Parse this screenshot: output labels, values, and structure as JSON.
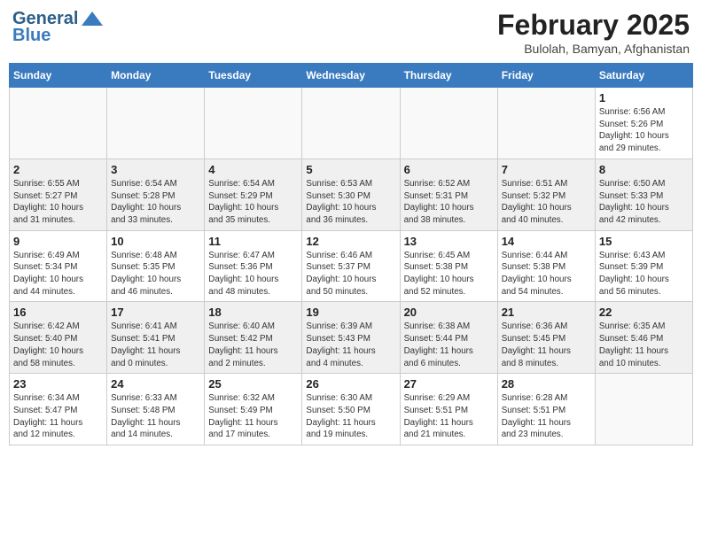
{
  "header": {
    "logo_general": "General",
    "logo_blue": "Blue",
    "month": "February 2025",
    "location": "Bulolah, Bamyan, Afghanistan"
  },
  "weekdays": [
    "Sunday",
    "Monday",
    "Tuesday",
    "Wednesday",
    "Thursday",
    "Friday",
    "Saturday"
  ],
  "weeks": [
    [
      {
        "day": "",
        "info": ""
      },
      {
        "day": "",
        "info": ""
      },
      {
        "day": "",
        "info": ""
      },
      {
        "day": "",
        "info": ""
      },
      {
        "day": "",
        "info": ""
      },
      {
        "day": "",
        "info": ""
      },
      {
        "day": "1",
        "info": "Sunrise: 6:56 AM\nSunset: 5:26 PM\nDaylight: 10 hours\nand 29 minutes."
      }
    ],
    [
      {
        "day": "2",
        "info": "Sunrise: 6:55 AM\nSunset: 5:27 PM\nDaylight: 10 hours\nand 31 minutes."
      },
      {
        "day": "3",
        "info": "Sunrise: 6:54 AM\nSunset: 5:28 PM\nDaylight: 10 hours\nand 33 minutes."
      },
      {
        "day": "4",
        "info": "Sunrise: 6:54 AM\nSunset: 5:29 PM\nDaylight: 10 hours\nand 35 minutes."
      },
      {
        "day": "5",
        "info": "Sunrise: 6:53 AM\nSunset: 5:30 PM\nDaylight: 10 hours\nand 36 minutes."
      },
      {
        "day": "6",
        "info": "Sunrise: 6:52 AM\nSunset: 5:31 PM\nDaylight: 10 hours\nand 38 minutes."
      },
      {
        "day": "7",
        "info": "Sunrise: 6:51 AM\nSunset: 5:32 PM\nDaylight: 10 hours\nand 40 minutes."
      },
      {
        "day": "8",
        "info": "Sunrise: 6:50 AM\nSunset: 5:33 PM\nDaylight: 10 hours\nand 42 minutes."
      }
    ],
    [
      {
        "day": "9",
        "info": "Sunrise: 6:49 AM\nSunset: 5:34 PM\nDaylight: 10 hours\nand 44 minutes."
      },
      {
        "day": "10",
        "info": "Sunrise: 6:48 AM\nSunset: 5:35 PM\nDaylight: 10 hours\nand 46 minutes."
      },
      {
        "day": "11",
        "info": "Sunrise: 6:47 AM\nSunset: 5:36 PM\nDaylight: 10 hours\nand 48 minutes."
      },
      {
        "day": "12",
        "info": "Sunrise: 6:46 AM\nSunset: 5:37 PM\nDaylight: 10 hours\nand 50 minutes."
      },
      {
        "day": "13",
        "info": "Sunrise: 6:45 AM\nSunset: 5:38 PM\nDaylight: 10 hours\nand 52 minutes."
      },
      {
        "day": "14",
        "info": "Sunrise: 6:44 AM\nSunset: 5:38 PM\nDaylight: 10 hours\nand 54 minutes."
      },
      {
        "day": "15",
        "info": "Sunrise: 6:43 AM\nSunset: 5:39 PM\nDaylight: 10 hours\nand 56 minutes."
      }
    ],
    [
      {
        "day": "16",
        "info": "Sunrise: 6:42 AM\nSunset: 5:40 PM\nDaylight: 10 hours\nand 58 minutes."
      },
      {
        "day": "17",
        "info": "Sunrise: 6:41 AM\nSunset: 5:41 PM\nDaylight: 11 hours\nand 0 minutes."
      },
      {
        "day": "18",
        "info": "Sunrise: 6:40 AM\nSunset: 5:42 PM\nDaylight: 11 hours\nand 2 minutes."
      },
      {
        "day": "19",
        "info": "Sunrise: 6:39 AM\nSunset: 5:43 PM\nDaylight: 11 hours\nand 4 minutes."
      },
      {
        "day": "20",
        "info": "Sunrise: 6:38 AM\nSunset: 5:44 PM\nDaylight: 11 hours\nand 6 minutes."
      },
      {
        "day": "21",
        "info": "Sunrise: 6:36 AM\nSunset: 5:45 PM\nDaylight: 11 hours\nand 8 minutes."
      },
      {
        "day": "22",
        "info": "Sunrise: 6:35 AM\nSunset: 5:46 PM\nDaylight: 11 hours\nand 10 minutes."
      }
    ],
    [
      {
        "day": "23",
        "info": "Sunrise: 6:34 AM\nSunset: 5:47 PM\nDaylight: 11 hours\nand 12 minutes."
      },
      {
        "day": "24",
        "info": "Sunrise: 6:33 AM\nSunset: 5:48 PM\nDaylight: 11 hours\nand 14 minutes."
      },
      {
        "day": "25",
        "info": "Sunrise: 6:32 AM\nSunset: 5:49 PM\nDaylight: 11 hours\nand 17 minutes."
      },
      {
        "day": "26",
        "info": "Sunrise: 6:30 AM\nSunset: 5:50 PM\nDaylight: 11 hours\nand 19 minutes."
      },
      {
        "day": "27",
        "info": "Sunrise: 6:29 AM\nSunset: 5:51 PM\nDaylight: 11 hours\nand 21 minutes."
      },
      {
        "day": "28",
        "info": "Sunrise: 6:28 AM\nSunset: 5:51 PM\nDaylight: 11 hours\nand 23 minutes."
      },
      {
        "day": "",
        "info": ""
      }
    ]
  ]
}
